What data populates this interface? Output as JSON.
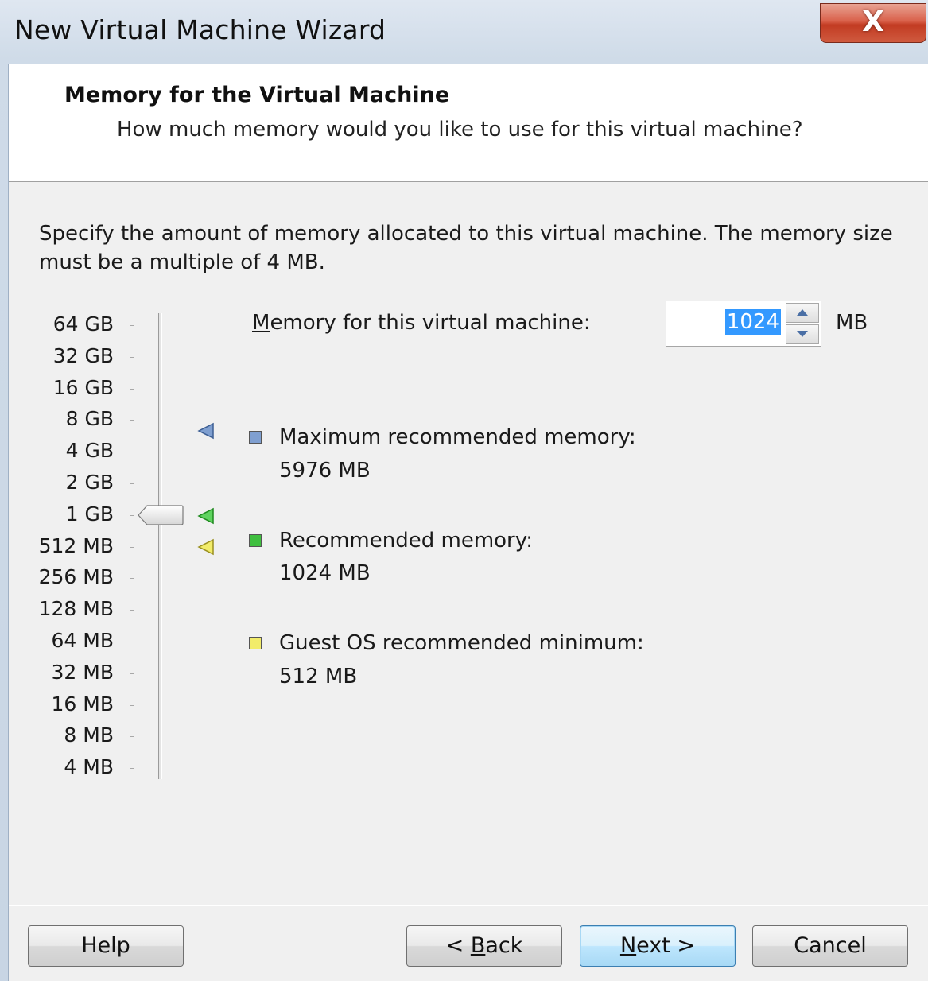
{
  "window": {
    "title": "New Virtual Machine Wizard",
    "close_glyph": "X"
  },
  "header": {
    "title": "Memory for the Virtual Machine",
    "subtitle": "How much memory would you like to use for this virtual machine?"
  },
  "description": "Specify the amount of memory allocated to this virtual machine. The memory size must be a multiple of 4 MB.",
  "memory_field": {
    "label_accesskey": "M",
    "label_rest": "emory for this virtual machine:",
    "value": "1024",
    "unit": "MB"
  },
  "scale": {
    "labels": [
      "64 GB",
      "32 GB",
      "16 GB",
      "8 GB",
      "4 GB",
      "2 GB",
      "1 GB",
      "512 MB",
      "256 MB",
      "128 MB",
      "64 MB",
      "32 MB",
      "16 MB",
      "8 MB",
      "4 MB"
    ],
    "selected_label": "1 GB"
  },
  "recommendations": {
    "max": {
      "label": "Maximum recommended memory:",
      "value": "5976 MB",
      "color": "#7f9fd0"
    },
    "recommended": {
      "label": "Recommended memory:",
      "value": "1024 MB",
      "color": "#3fbf3f"
    },
    "minimum": {
      "label": "Guest OS recommended minimum:",
      "value": "512 MB",
      "color": "#f2ec6a"
    }
  },
  "buttons": {
    "help": "Help",
    "back_prefix": "< ",
    "back_accesskey": "B",
    "back_rest": "ack",
    "next_accesskey": "N",
    "next_rest": "ext >",
    "cancel": "Cancel"
  }
}
